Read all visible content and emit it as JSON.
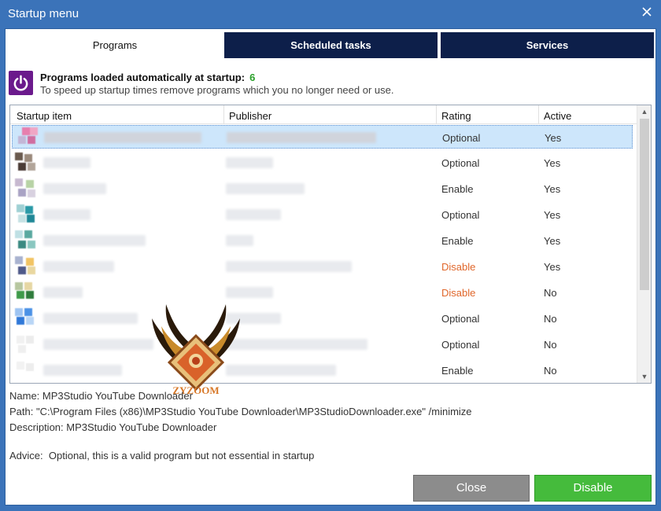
{
  "window": {
    "title": "Startup menu"
  },
  "tabs": [
    {
      "label": "Programs",
      "active": true
    },
    {
      "label": "Scheduled tasks",
      "active": false
    },
    {
      "label": "Services",
      "active": false
    }
  ],
  "header": {
    "title": "Programs loaded automatically at startup:",
    "count": "6",
    "subtitle": "To speed up startup times remove programs which you no longer need or use."
  },
  "table": {
    "columns": [
      "Startup item",
      "Publisher",
      "Rating",
      "Active"
    ],
    "rows": [
      {
        "rating": "Optional",
        "active": "Yes",
        "selected": true
      },
      {
        "rating": "Optional",
        "active": "Yes"
      },
      {
        "rating": "Enable",
        "active": "Yes"
      },
      {
        "rating": "Optional",
        "active": "Yes"
      },
      {
        "rating": "Enable",
        "active": "Yes"
      },
      {
        "rating": "Disable",
        "active": "Yes"
      },
      {
        "rating": "Disable",
        "active": "No"
      },
      {
        "rating": "Optional",
        "active": "No"
      },
      {
        "rating": "Optional",
        "active": "No"
      },
      {
        "rating": "Enable",
        "active": "No"
      }
    ]
  },
  "details": {
    "name": "Name: MP3Studio YouTube Downloader",
    "path": "Path: \"C:\\Program Files (x86)\\MP3Studio YouTube Downloader\\MP3StudioDownloader.exe\" /minimize",
    "description": "Description:  MP3Studio YouTube Downloader",
    "advice_label": "Advice:",
    "advice_text": "Optional,  this is a valid program but not essential in startup"
  },
  "buttons": {
    "close": "Close",
    "disable": "Disable"
  },
  "watermark": {
    "text": "ZYZOOM"
  },
  "colors": {
    "titlebar": "#3b73b9",
    "tab_inactive": "#0d1f4a",
    "count": "#2aa02a",
    "disable_rating": "#e0662a",
    "btn_close": "#8c8c8c",
    "btn_disable": "#45bb3c",
    "power_icon_bg": "#6b1a8c"
  },
  "icons": [
    "power-icon",
    "close-icon",
    "scroll-up-icon",
    "scroll-down-icon"
  ]
}
